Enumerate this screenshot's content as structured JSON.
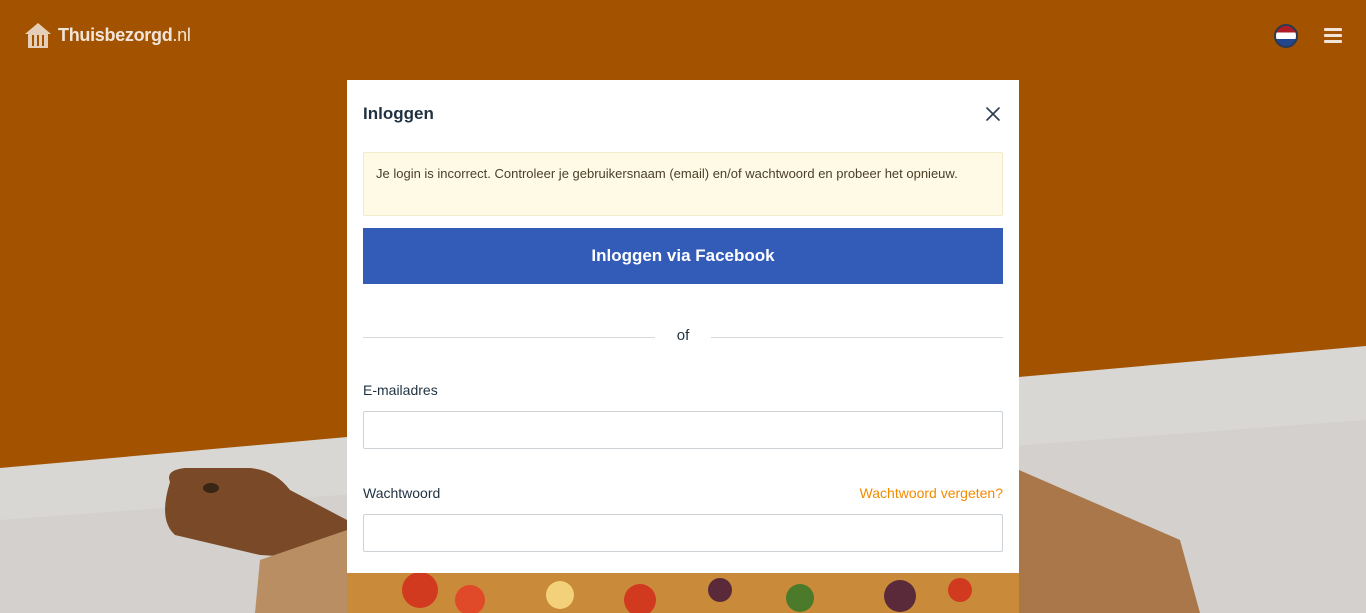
{
  "header": {
    "logo_name": "Thuisbezorgd",
    "logo_tld": ".nl",
    "language_flag": "netherlands-flag-icon",
    "menu_icon": "hamburger-menu-icon"
  },
  "modal": {
    "title": "Inloggen",
    "close_icon": "close-icon",
    "alert_text": "Je login is incorrect. Controleer je gebruikersnaam (email) en/of wachtwoord en probeer het opnieuw.",
    "facebook_button": "Inloggen via Facebook",
    "divider_text": "of",
    "email_label": "E-mailadres",
    "email_value": "",
    "password_label": "Wachtwoord",
    "password_value": "",
    "forgot_password": "Wachtwoord vergeten?"
  },
  "colors": {
    "brand_orange": "#a35300",
    "facebook_blue": "#335cb9",
    "link_orange": "#f28b00",
    "alert_bg": "#fffae6"
  }
}
